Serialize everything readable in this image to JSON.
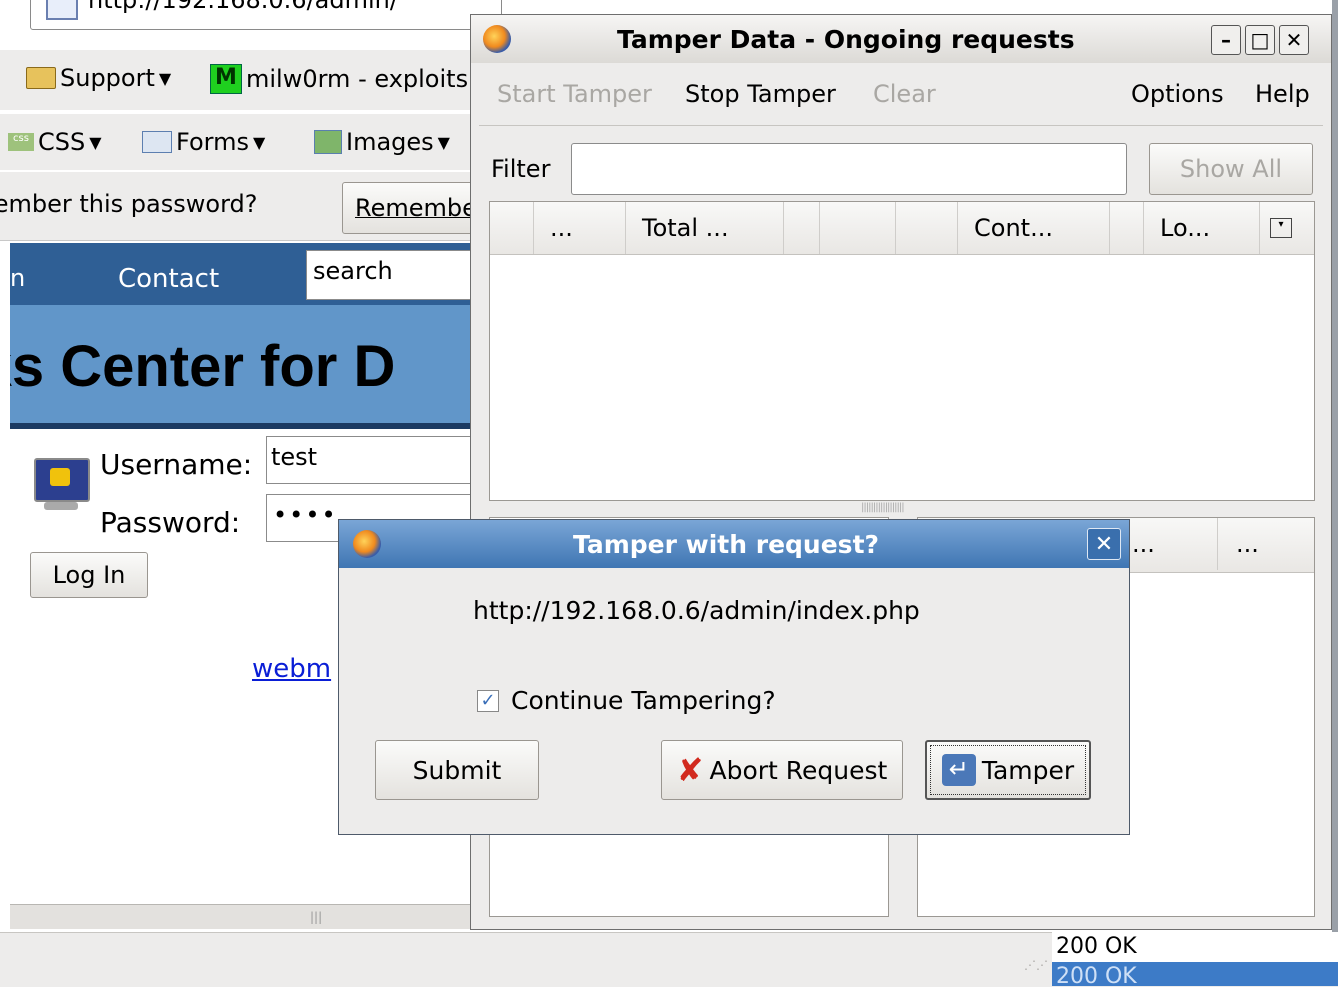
{
  "browser": {
    "url": "http://192.168.0.6/admin/",
    "bookmarks": [
      {
        "label": "Support",
        "icon": "folder-icon"
      },
      {
        "label": "milw0rm - exploits",
        "icon": "milw0rm-icon"
      }
    ],
    "toolbar": [
      {
        "label": "CSS",
        "icon": "css-icon"
      },
      {
        "label": "Forms",
        "icon": "forms-icon"
      },
      {
        "label": "Images",
        "icon": "images-icon"
      }
    ],
    "password_prompt": {
      "text": "Remember this password?",
      "button": "Remember"
    },
    "site_nav": {
      "item": "Contact",
      "search_value": "search"
    },
    "banner_title": "Banks Center for D",
    "login": {
      "username_label": "Username:",
      "username_value": "test",
      "password_label": "Password:",
      "password_value": "••••",
      "login_button": "Log In",
      "link": "webm"
    },
    "status": [
      "200 OK",
      "200 OK"
    ]
  },
  "tamper_window": {
    "title": "Tamper Data - Ongoing requests",
    "menu": {
      "start": "Start Tamper",
      "stop": "Stop Tamper",
      "clear": "Clear",
      "options": "Options",
      "help": "Help"
    },
    "filter_label": "Filter",
    "filter_value": "",
    "show_all": "Show All",
    "columns": [
      "...",
      "Total ...",
      "",
      "",
      "Cont...",
      "Lo..."
    ],
    "lower_columns": [
      "...",
      "..."
    ]
  },
  "dialog": {
    "title": "Tamper with request?",
    "url": "http://192.168.0.6/admin/index.php",
    "checkbox_label": "Continue Tampering?",
    "checkbox_checked": true,
    "submit": "Submit",
    "abort": "Abort Request",
    "tamper": "Tamper"
  }
}
